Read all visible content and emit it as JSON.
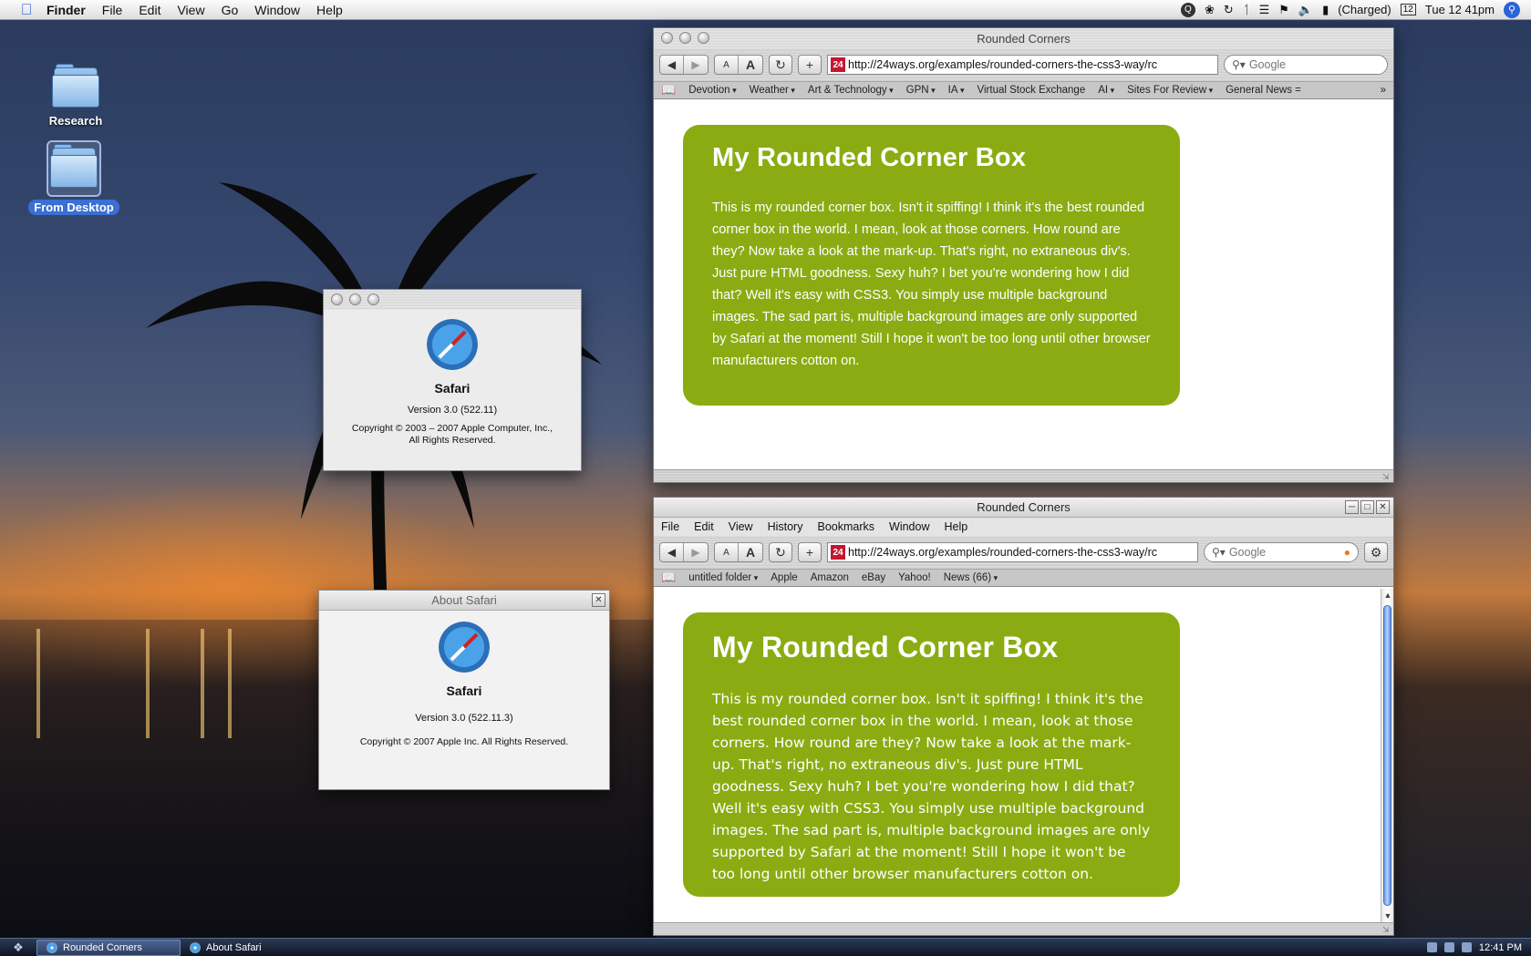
{
  "menubar": {
    "app": "Finder",
    "items": [
      "File",
      "Edit",
      "View",
      "Go",
      "Window",
      "Help"
    ],
    "battery": "(Charged)",
    "clock": "Tue 12 41pm",
    "calendar_day": "12"
  },
  "desktop": {
    "icons": [
      {
        "label": "Research"
      },
      {
        "label": "From Desktop"
      }
    ]
  },
  "safari_mac": {
    "title": "Rounded Corners",
    "url": "http://24ways.org/examples/rounded-corners-the-css3-way/rc",
    "search_placeholder": "Google",
    "text_small": "A",
    "text_large": "A",
    "bookmarks": [
      {
        "label": "Devotion",
        "menu": true
      },
      {
        "label": "Weather",
        "menu": true
      },
      {
        "label": "Art & Technology",
        "menu": true
      },
      {
        "label": "GPN",
        "menu": true
      },
      {
        "label": "IA",
        "menu": true
      },
      {
        "label": "Virtual Stock Exchange",
        "menu": false
      },
      {
        "label": "AI",
        "menu": true
      },
      {
        "label": "Sites For Review",
        "menu": true
      },
      {
        "label": "General News =",
        "menu": false
      }
    ],
    "box_heading": "My Rounded Corner Box",
    "box_text": "This is my rounded corner box. Isn't it spiffing! I think it's the best rounded corner box in the world. I mean, look at those corners. How round are they? Now take a look at the mark-up. That's right, no extraneous div's. Just pure HTML goodness. Sexy huh? I bet you're wondering how I did that? Well it's easy with CSS3. You simply use multiple background images. The sad part is, multiple background images are only supported by Safari at the moment! Still I hope it won't be too long until other browser manufacturers cotton on."
  },
  "safari_win": {
    "title": "Rounded Corners",
    "menu": [
      "File",
      "Edit",
      "View",
      "History",
      "Bookmarks",
      "Window",
      "Help"
    ],
    "url": "http://24ways.org/examples/rounded-corners-the-css3-way/rc",
    "search_placeholder": "Google",
    "text_small": "A",
    "text_large": "A",
    "bookmarks": [
      {
        "label": "untitled folder",
        "menu": true
      },
      {
        "label": "Apple",
        "menu": false
      },
      {
        "label": "Amazon",
        "menu": false
      },
      {
        "label": "eBay",
        "menu": false
      },
      {
        "label": "Yahoo!",
        "menu": false
      },
      {
        "label": "News (66)",
        "menu": true
      }
    ],
    "box_heading": "My Rounded Corner Box",
    "box_text": "This is my rounded corner box. Isn't it spiffing! I think it's the best rounded corner box in the world. I mean, look at those corners. How round are they? Now take a look at the mark-up. That's right, no extraneous div's. Just pure HTML goodness. Sexy huh? I bet you're wondering how I did that? Well it's easy with CSS3. You simply use multiple background images. The sad part is, multiple background images are only supported by Safari at the moment! Still I hope it won't be too long until other browser manufacturers cotton on."
  },
  "about_mac": {
    "app_name": "Safari",
    "version": "Version 3.0 (522.11)",
    "copyright_line1": "Copyright © 2003 – 2007 Apple Computer, Inc.,",
    "copyright_line2": "All Rights Reserved."
  },
  "about_win": {
    "title": "About Safari",
    "app_name": "Safari",
    "version": "Version 3.0 (522.11.3)",
    "copyright": "Copyright © 2007 Apple Inc. All Rights Reserved."
  },
  "taskbar": {
    "tasks": [
      {
        "label": "Rounded Corners"
      },
      {
        "label": "About Safari"
      }
    ],
    "clock": "12:41 PM"
  },
  "colors": {
    "box_green": "#8aac12",
    "favicon_red": "#c6162f",
    "selection_blue": "#3a6fd4"
  }
}
